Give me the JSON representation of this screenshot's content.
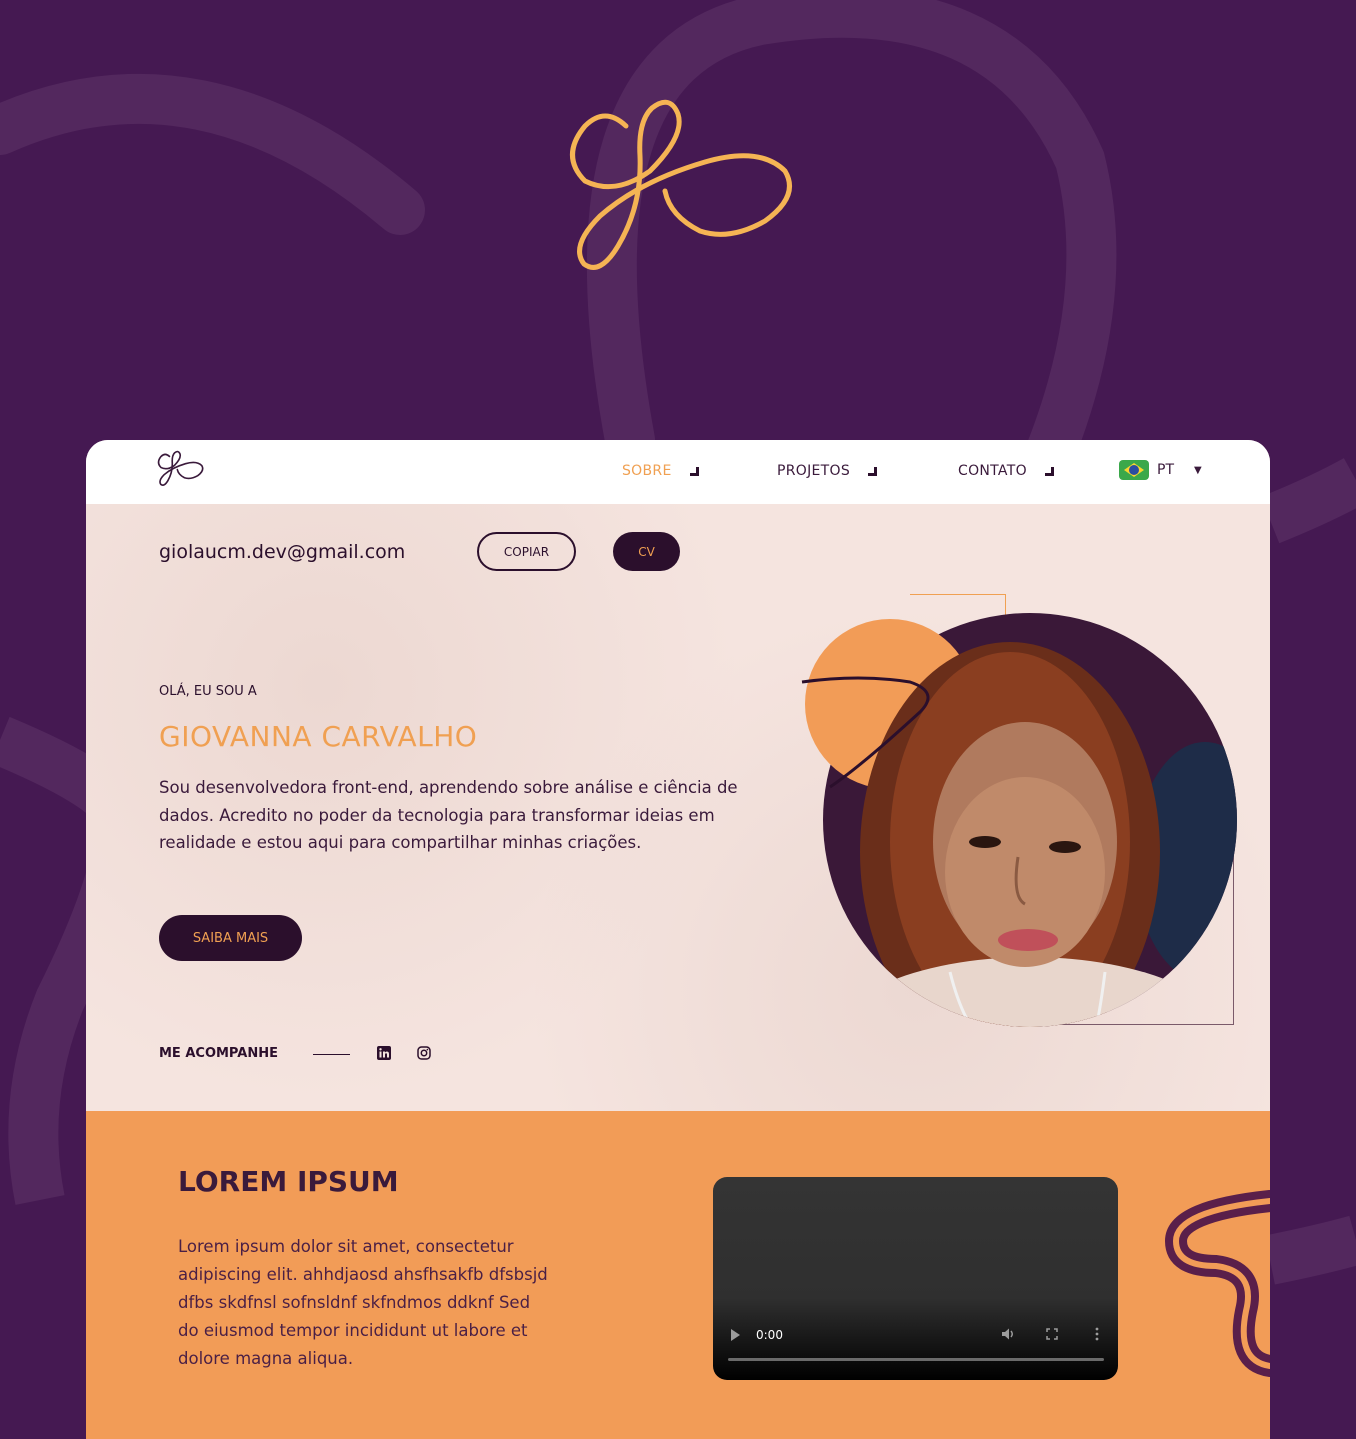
{
  "nav": {
    "links": [
      {
        "label": "SOBRE",
        "active": true
      },
      {
        "label": "PROJETOS",
        "active": false
      },
      {
        "label": "CONTATO",
        "active": false
      }
    ],
    "language": "PT"
  },
  "contact": {
    "email": "giolaucm.dev@gmail.com",
    "copy_label": "COPIAR",
    "cv_label": "CV"
  },
  "hero": {
    "greeting": "OLÁ, EU SOU A",
    "name": "GIOVANNA CARVALHO",
    "bio": "Sou desenvolvedora front-end, aprendendo sobre análise e ciência de dados. Acredito no poder da tecnologia para transformar ideias em realidade e estou aqui para compartilhar minhas criações.",
    "cta_label": "SAIBA MAIS",
    "follow_label": "ME ACOMPANHE",
    "social_icons": [
      "linkedin-icon",
      "instagram-icon"
    ]
  },
  "section2": {
    "title": "LOREM IPSUM",
    "text": "Lorem ipsum dolor sit amet, consectetur adipiscing elit. ahhdjaosd ahsfhsakfb dfsbsjd dfbs skdfnsl sofnsldnf skfndmos ddknf Sed do eiusmod tempor incididunt ut labore et dolore magna aliqua.",
    "video_time": "0:00"
  },
  "colors": {
    "background": "#451952",
    "accent": "#f0a052",
    "dark": "#2b0f2c",
    "section_orange": "#f29c57"
  }
}
